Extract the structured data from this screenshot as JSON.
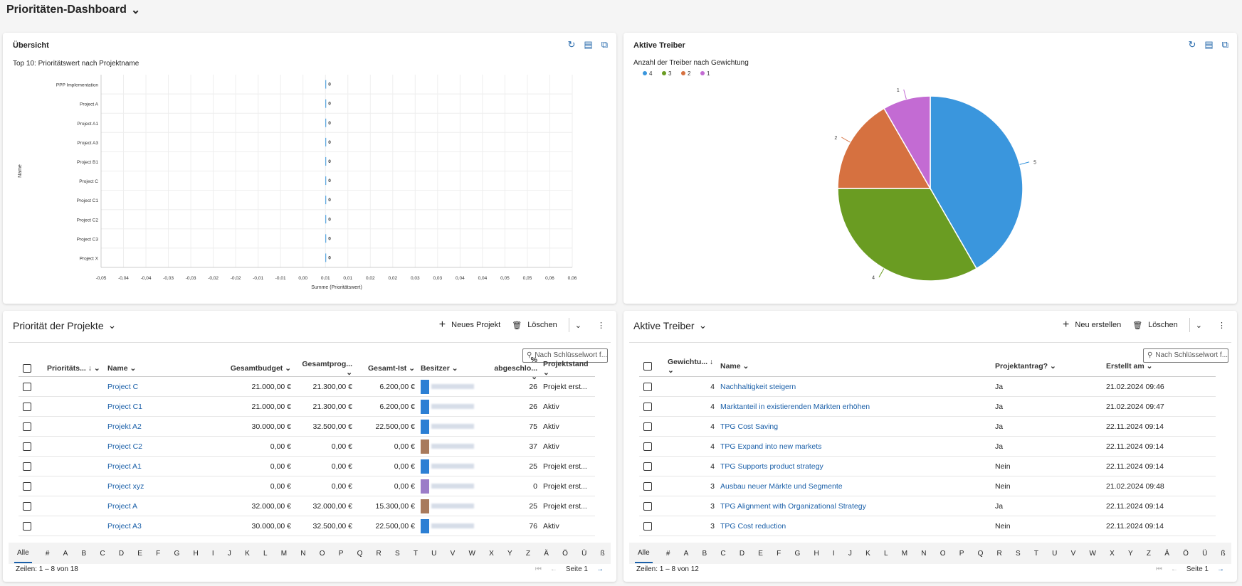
{
  "title": "Prioritäten-Dashboard",
  "overview": {
    "heading": "Übersicht",
    "subtitle": "Top 10: Prioritätswert nach Projektname"
  },
  "drivers_chart": {
    "heading": "Aktive Treiber",
    "subtitle": "Anzahl der Treiber nach Gewichtung"
  },
  "chart_data": [
    {
      "type": "bar",
      "orientation": "horizontal",
      "title": "Top 10: Prioritätswert nach Projektname",
      "xlabel": "Summe (Prioritätswert)",
      "ylabel": "Name",
      "categories": [
        "PPP Implementation",
        "Project A",
        "Project A1",
        "Project A3",
        "Project B1",
        "Project C",
        "Project C1",
        "Project C2",
        "Project C3",
        "Project X"
      ],
      "values": [
        0,
        0,
        0,
        0,
        0,
        0,
        0,
        0,
        0,
        0
      ],
      "data_labels": [
        "0",
        "0",
        "0",
        "0",
        "0",
        "0",
        "0",
        "0",
        "0",
        "0"
      ],
      "xlim": [
        -0.05,
        0.055
      ],
      "xticks": [
        "-0,05",
        "-0,04",
        "-0,04",
        "-0,03",
        "-0,03",
        "-0,02",
        "-0,02",
        "-0,01",
        "-0,01",
        "0,00",
        "0,01",
        "0,01",
        "0,02",
        "0,02",
        "0,03",
        "0,03",
        "0,04",
        "0,04",
        "0,05",
        "0,05",
        "0,06",
        "0,06"
      ],
      "grid": true,
      "color": "#3a96dd"
    },
    {
      "type": "pie",
      "title": "Anzahl der Treiber nach Gewichtung",
      "legend": "top-left",
      "slices": [
        {
          "label": "4",
          "value": 5,
          "color": "#3a96dd"
        },
        {
          "label": "3",
          "value": 4,
          "color": "#6a9c22"
        },
        {
          "label": "2",
          "value": 2,
          "color": "#d67140"
        },
        {
          "label": "1",
          "value": 1,
          "color": "#c36bd3"
        }
      ]
    }
  ],
  "projects": {
    "heading": "Priorität der Projekte",
    "new": "Neues Projekt",
    "delete": "Löschen",
    "search_placeholder": "Nach Schlüsselwort f...",
    "columns": [
      "Prioritäts...",
      "Name",
      "Gesamtbudget",
      "Gesamtprog...",
      "Gesamt-Ist",
      "Besitzer",
      "% abgeschlo...",
      "Projektstand"
    ],
    "rows": [
      {
        "name": "Project C",
        "budget": "21.000,00 €",
        "prog": "21.300,00 €",
        "ist": "6.200,00 €",
        "pct": "26",
        "stand": "Projekt erst...",
        "owner_color": "#2b7fd4"
      },
      {
        "name": "Project C1",
        "budget": "21.000,00 €",
        "prog": "21.300,00 €",
        "ist": "6.200,00 €",
        "pct": "26",
        "stand": "Aktiv",
        "owner_color": "#2b7fd4"
      },
      {
        "name": "Projekt A2",
        "budget": "30.000,00 €",
        "prog": "32.500,00 €",
        "ist": "22.500,00 €",
        "pct": "75",
        "stand": "Aktiv",
        "owner_color": "#2b7fd4"
      },
      {
        "name": "Project C2",
        "budget": "0,00 €",
        "prog": "0,00 €",
        "ist": "0,00 €",
        "pct": "37",
        "stand": "Aktiv",
        "owner_color": "#a87a5c"
      },
      {
        "name": "Project A1",
        "budget": "0,00 €",
        "prog": "0,00 €",
        "ist": "0,00 €",
        "pct": "25",
        "stand": "Projekt erst...",
        "owner_color": "#2b7fd4"
      },
      {
        "name": "Project xyz",
        "budget": "0,00 €",
        "prog": "0,00 €",
        "ist": "0,00 €",
        "pct": "0",
        "stand": "Projekt erst...",
        "owner_color": "#9b7cc8"
      },
      {
        "name": "Project A",
        "budget": "32.000,00 €",
        "prog": "32.000,00 €",
        "ist": "15.300,00 €",
        "pct": "25",
        "stand": "Projekt erst...",
        "owner_color": "#a87a5c"
      },
      {
        "name": "Project A3",
        "budget": "30.000,00 €",
        "prog": "32.500,00 €",
        "ist": "22.500,00 €",
        "pct": "76",
        "stand": "Aktiv",
        "owner_color": "#2b7fd4"
      }
    ],
    "footer": "Zeilen: 1 – 8 von 18",
    "page": "Seite 1"
  },
  "drivers": {
    "heading": "Aktive Treiber",
    "new": "Neu erstellen",
    "delete": "Löschen",
    "search_placeholder": "Nach Schlüsselwort f...",
    "columns": [
      "Gewichtu...",
      "Name",
      "Projektantrag?",
      "Erstellt am"
    ],
    "rows": [
      {
        "w": "4",
        "name": "Nachhaltigkeit steigern",
        "antrag": "Ja",
        "date": "21.02.2024 09:46"
      },
      {
        "w": "4",
        "name": "Marktanteil in existierenden Märkten erhöhen",
        "antrag": "Ja",
        "date": "21.02.2024 09:47"
      },
      {
        "w": "4",
        "name": "TPG Cost Saving",
        "antrag": "Ja",
        "date": "22.11.2024 09:14"
      },
      {
        "w": "4",
        "name": "TPG Expand into new markets",
        "antrag": "Ja",
        "date": "22.11.2024 09:14"
      },
      {
        "w": "4",
        "name": "TPG Supports product strategy",
        "antrag": "Nein",
        "date": "22.11.2024 09:14"
      },
      {
        "w": "3",
        "name": "Ausbau neuer Märkte und Segmente",
        "antrag": "Nein",
        "date": "21.02.2024 09:48"
      },
      {
        "w": "3",
        "name": "TPG Alignment with Organizational Strategy",
        "antrag": "Ja",
        "date": "22.11.2024 09:14"
      },
      {
        "w": "3",
        "name": "TPG Cost reduction",
        "antrag": "Nein",
        "date": "22.11.2024 09:14"
      }
    ],
    "footer": "Zeilen: 1 – 8 von 12",
    "page": "Seite 1"
  },
  "alphabet": [
    "Alle",
    "#",
    "A",
    "B",
    "C",
    "D",
    "E",
    "F",
    "G",
    "H",
    "I",
    "J",
    "K",
    "L",
    "M",
    "N",
    "O",
    "P",
    "Q",
    "R",
    "S",
    "T",
    "U",
    "V",
    "W",
    "X",
    "Y",
    "Z",
    "Ä",
    "Ö",
    "Ü",
    "ß"
  ]
}
